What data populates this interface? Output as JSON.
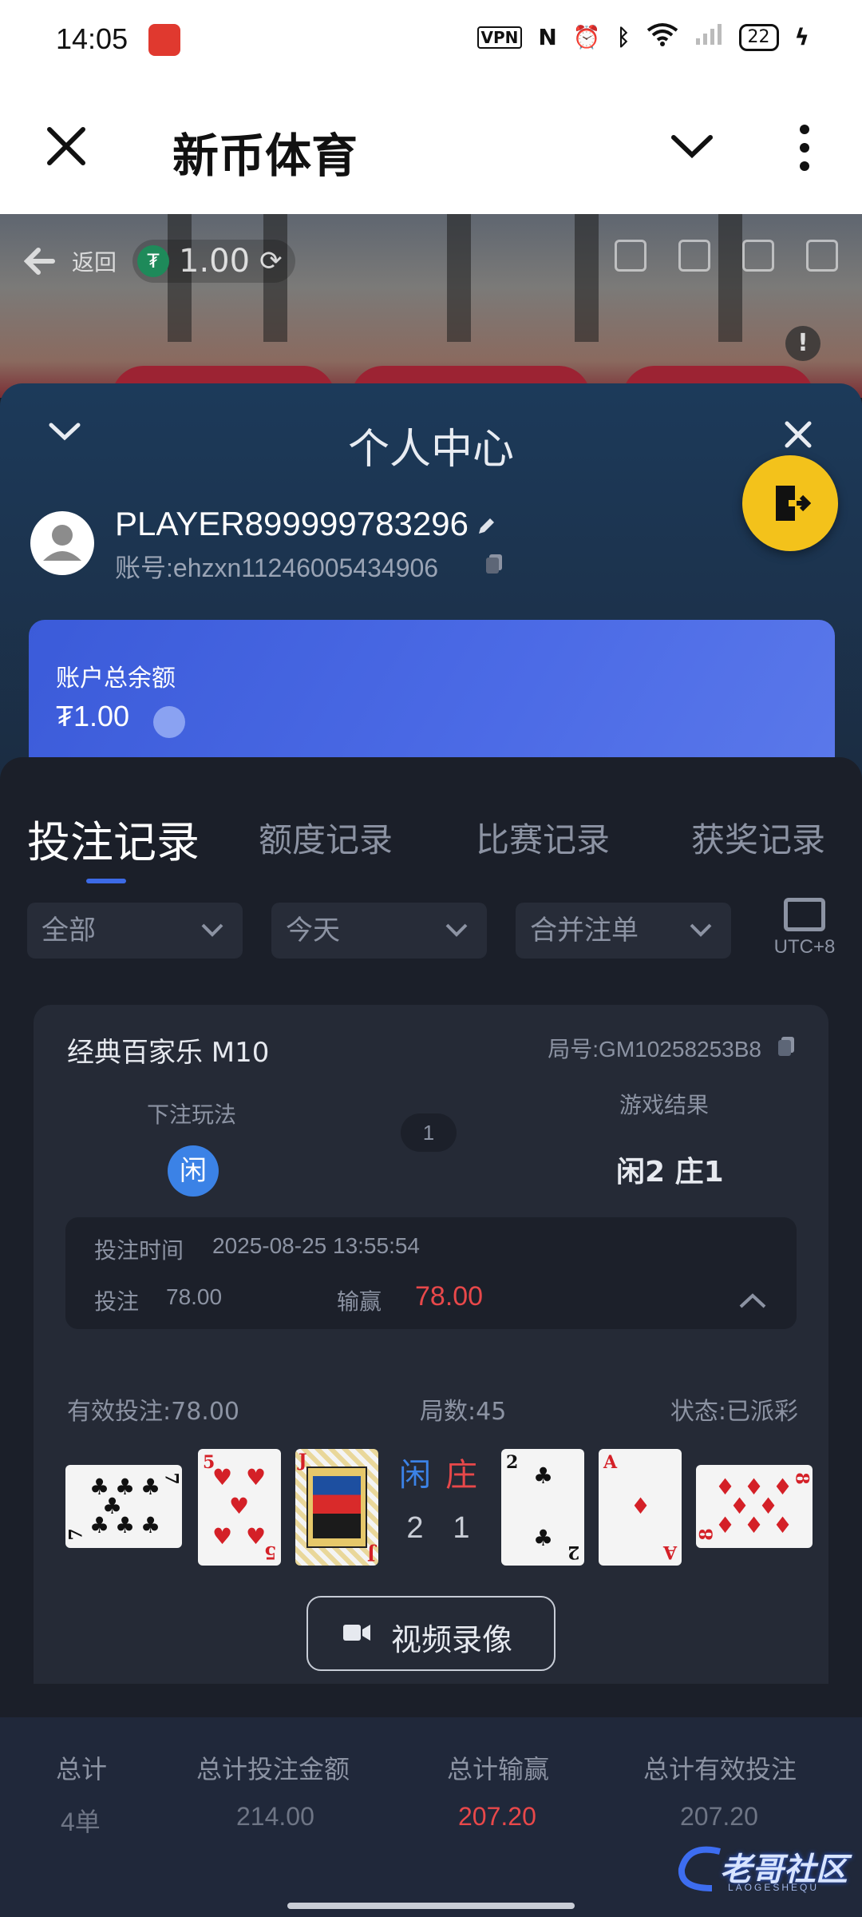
{
  "status_bar": {
    "time": "14:05",
    "battery": "22",
    "icons": [
      "vpn-icon",
      "nfc-icon",
      "alarm-icon",
      "bluetooth-icon",
      "wifi-icon",
      "signal-icon",
      "battery-icon",
      "charging-icon"
    ]
  },
  "title_bar": {
    "title": "新币体育"
  },
  "video_bar": {
    "back_label": "返回",
    "balance": "1.00",
    "coin_symbol": "₮"
  },
  "panel": {
    "title": "个人中心",
    "player_name": "PLAYER899999783296",
    "account_label": "账号:",
    "account_value": "ehzxn11246005434906",
    "balance_label": "账户总余额",
    "balance_value": "₮1.00"
  },
  "tabs": [
    {
      "label": "投注记录",
      "active": true
    },
    {
      "label": "额度记录",
      "active": false
    },
    {
      "label": "比赛记录",
      "active": false
    },
    {
      "label": "获奖记录",
      "active": false
    }
  ],
  "filters": {
    "type": "全部",
    "date": "今天",
    "merge": "合并注单",
    "timezone": "UTC+8"
  },
  "record": {
    "game_name": "经典百家乐 M10",
    "round_id": "局号:GM10258253B8",
    "bet_type_label": "下注玩法",
    "bet_type_value": "闲",
    "count": "1",
    "result_label": "游戏结果",
    "result_value": "闲2 庄1",
    "bet_time_label": "投注时间",
    "bet_time_value": "2025-08-25 13:55:54",
    "bet_label": "投注",
    "bet_value": "78.00",
    "win_label": "输赢",
    "win_value": "78.00",
    "valid_bet": "有效投注:78.00",
    "rounds": "局数:45",
    "status": "状态:已派彩",
    "player_label": "闲",
    "banker_label": "庄",
    "player_score": "2",
    "banker_score": "1",
    "video_button": "视频录像",
    "player_cards": [
      {
        "rank": "7",
        "suit": "♣"
      },
      {
        "rank": "5",
        "suit": "♥"
      },
      {
        "rank": "J",
        "suit": "♦"
      }
    ],
    "banker_cards": [
      {
        "rank": "2",
        "suit": "♣"
      },
      {
        "rank": "A",
        "suit": "♦"
      },
      {
        "rank": "8",
        "suit": "♦"
      }
    ]
  },
  "summary": {
    "total_label": "总计",
    "total_value": "4单",
    "bet_amount_label": "总计投注金额",
    "bet_amount_value": "214.00",
    "win_label": "总计输赢",
    "win_value": "207.20",
    "valid_label": "总计有效投注",
    "valid_value": "207.20"
  },
  "watermark": {
    "text": "老哥社区",
    "sub": "LAOGESHEQU"
  },
  "colors": {
    "accent_blue": "#3c6ae6",
    "loss_red": "#e8484a",
    "logout_yellow": "#f3c21b"
  }
}
